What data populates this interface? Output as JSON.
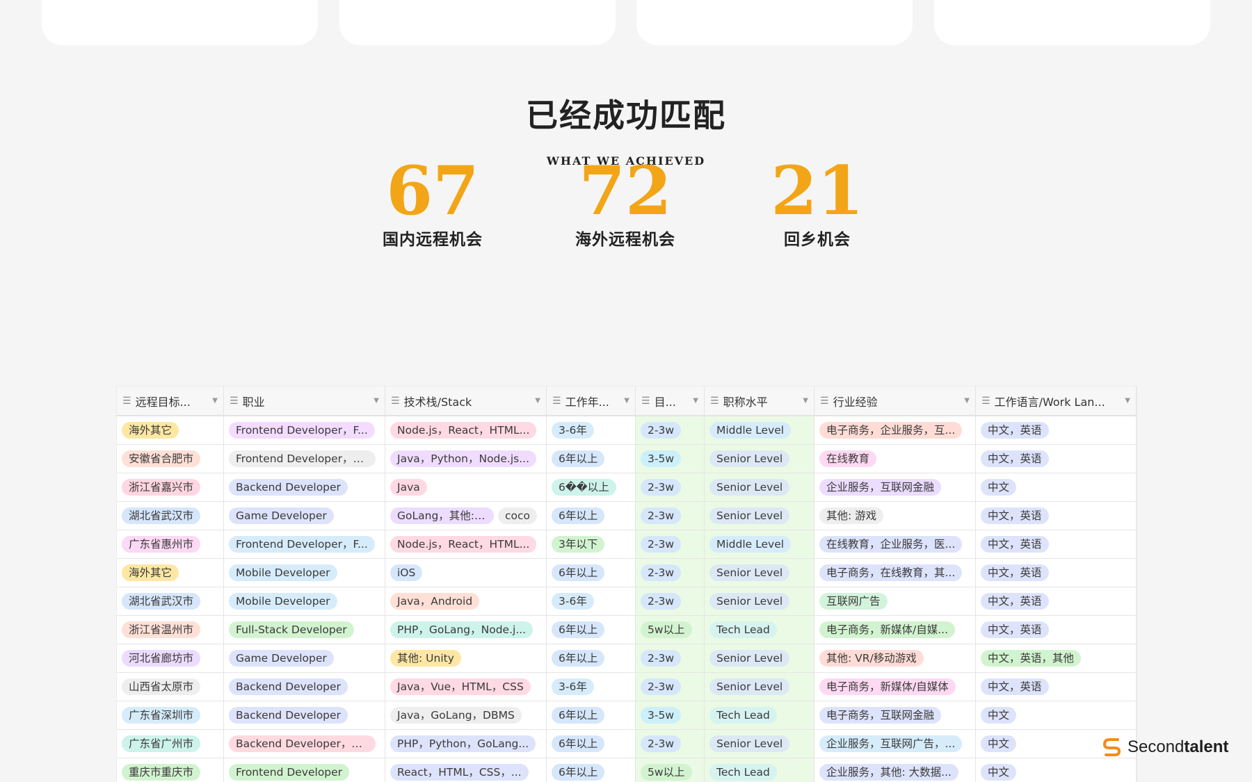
{
  "colors": {
    "accent": "#f2a516",
    "page_bg": "#f5f5f5"
  },
  "achieve": {
    "title": "已经成功匹配",
    "subtitle": "WHAT WE ACHIEVED",
    "stats": [
      {
        "value": "67",
        "label": "国内远程机会"
      },
      {
        "value": "72",
        "label": "海外远程机会"
      },
      {
        "value": "21",
        "label": "回乡机会"
      }
    ]
  },
  "table": {
    "field_icon": "field-list-icon",
    "columns": [
      "远程目标...",
      "职业",
      "技术栈/Stack",
      "工作年...",
      "目...",
      "职称水平",
      "行业经验",
      "工作语言/Work Lan..."
    ],
    "rows": [
      [
        {
          "t": "海外其它",
          "c": "#fde7a3"
        },
        {
          "t": "Frontend Developer，F...",
          "c": "#f3dcff"
        },
        {
          "t": "Node.js，React，HTML...",
          "c": "#ffd9e4"
        },
        {
          "t": "3-6年",
          "c": "#d6ecfb"
        },
        {
          "t": "2-3w",
          "c": "#d6e6fb"
        },
        {
          "t": "Middle Level",
          "c": "#d6ecfb"
        },
        {
          "t": "电子商务，企业服务，互...",
          "c": "#ffdcd6"
        },
        {
          "t": "中文，英语",
          "c": "#dde3fb"
        }
      ],
      [
        {
          "t": "安徽省合肥市",
          "c": "#fde0d6"
        },
        {
          "t": "Frontend Developer，B...",
          "c": "#eeeeee"
        },
        {
          "t": "Java，Python，Node.js...",
          "c": "#f0dcff"
        },
        {
          "t": "6年以上",
          "c": "#d6e6fb"
        },
        {
          "t": "3-5w",
          "c": "#cdeffb"
        },
        {
          "t": "Senior Level",
          "c": "#dde8f5"
        },
        {
          "t": "在线教育",
          "c": "#fdd9f2"
        },
        {
          "t": "中文，英语",
          "c": "#dde3fb"
        }
      ],
      [
        {
          "t": "浙江省嘉兴市",
          "c": "#ffd6e2"
        },
        {
          "t": "Backend Developer",
          "c": "#dde3fb"
        },
        {
          "t": "Java",
          "c": "#ffd9e4"
        },
        {
          "t": "6��以上",
          "c": "#cdf3ea"
        },
        {
          "t": "2-3w",
          "c": "#d6e6fb"
        },
        {
          "t": "Senior Level",
          "c": "#dde8f5"
        },
        {
          "t": "企业服务，互联网金融",
          "c": "#ecdcff"
        },
        {
          "t": "中文",
          "c": "#dde3fb"
        }
      ],
      [
        {
          "t": "湖北省武汉市",
          "c": "#d6e6fb"
        },
        {
          "t": "Game Developer",
          "c": "#dde3fb"
        },
        {
          "t": "GoLang，其他: c++",
          "c": "#ecdcff"
        },
        {
          "t": "6年以上",
          "c": "#d6e6fb"
        },
        {
          "t": "2-3w",
          "c": "#d6e6fb"
        },
        {
          "t": "Senior Level",
          "c": "#dde8f5"
        },
        {
          "t": "其他: 游戏",
          "c": "#eeeeee"
        },
        {
          "t": "中文，英语",
          "c": "#dde3fb"
        }
      ],
      [
        {
          "t": "广东省惠州市",
          "c": "#fcd9f5"
        },
        {
          "t": "Frontend Developer，F...",
          "c": "#d6ecfb"
        },
        {
          "t": "Node.js，React，HTML...",
          "c": "#ffd9e4"
        },
        {
          "t": "3年以下",
          "c": "#d2f3cf"
        },
        {
          "t": "2-3w",
          "c": "#d6e6fb"
        },
        {
          "t": "Middle Level",
          "c": "#d6ecfb"
        },
        {
          "t": "在线教育，企业服务，医...",
          "c": "#dde3fb"
        },
        {
          "t": "中文，英语",
          "c": "#dde3fb"
        }
      ],
      [
        {
          "t": "海外其它",
          "c": "#fde7a3"
        },
        {
          "t": "Mobile Developer",
          "c": "#d6ecfb"
        },
        {
          "t": "iOS",
          "c": "#d6e6fb"
        },
        {
          "t": "6年以上",
          "c": "#d6e6fb"
        },
        {
          "t": "2-3w",
          "c": "#d6e6fb"
        },
        {
          "t": "Senior Level",
          "c": "#dde8f5"
        },
        {
          "t": "电子商务，在线教育，其...",
          "c": "#dde3fb"
        },
        {
          "t": "中文，英语",
          "c": "#dde3fb"
        }
      ],
      [
        {
          "t": "湖北省武汉市",
          "c": "#d6e6fb"
        },
        {
          "t": "Mobile Developer",
          "c": "#d6ecfb"
        },
        {
          "t": "Java，Android",
          "c": "#ffdfd6"
        },
        {
          "t": "3-6年",
          "c": "#d6ecfb"
        },
        {
          "t": "2-3w",
          "c": "#d6e6fb"
        },
        {
          "t": "Senior Level",
          "c": "#dde8f5"
        },
        {
          "t": "互联网广告",
          "c": "#d2f3dc"
        },
        {
          "t": "中文，英语",
          "c": "#dde3fb"
        }
      ],
      [
        {
          "t": "浙江省温州市",
          "c": "#ffe0d6"
        },
        {
          "t": "Full-Stack Developer",
          "c": "#d2f3cf"
        },
        {
          "t": "PHP，GoLang，Node.j...",
          "c": "#cdf3ea"
        },
        {
          "t": "6年以上",
          "c": "#d6e6fb"
        },
        {
          "t": "5w以上",
          "c": "#d2f3cf"
        },
        {
          "t": "Tech Lead",
          "c": "#d6f3f0"
        },
        {
          "t": "电子商务，新媒体/自媒...",
          "c": "#d2f3cf"
        },
        {
          "t": "中文，英语",
          "c": "#dde3fb"
        }
      ],
      [
        {
          "t": "河北省廊坊市",
          "c": "#ecdcff"
        },
        {
          "t": "Game Developer",
          "c": "#dde3fb"
        },
        {
          "t": "其他: Unity",
          "c": "#fde7a3"
        },
        {
          "t": "6年以上",
          "c": "#d6e6fb"
        },
        {
          "t": "2-3w",
          "c": "#d6e6fb"
        },
        {
          "t": "Senior Level",
          "c": "#dde8f5"
        },
        {
          "t": "其他: VR/移动游戏",
          "c": "#ffdcd6"
        },
        {
          "t": "中文，英语，其他",
          "c": "#d2f3cf"
        }
      ],
      [
        {
          "t": "山西省太原市",
          "c": "#eeeeee"
        },
        {
          "t": "Backend Developer",
          "c": "#dde3fb"
        },
        {
          "t": "Java，Vue，HTML，CSS",
          "c": "#ffd9e4"
        },
        {
          "t": "3-6年",
          "c": "#d6ecfb"
        },
        {
          "t": "2-3w",
          "c": "#d6e6fb"
        },
        {
          "t": "Senior Level",
          "c": "#dde8f5"
        },
        {
          "t": "电子商务，新媒体/自媒体",
          "c": "#fdd9f2"
        },
        {
          "t": "中文，英语",
          "c": "#dde3fb"
        }
      ],
      [
        {
          "t": "广东省深圳市",
          "c": "#d6ecfb"
        },
        {
          "t": "Backend Developer",
          "c": "#dde3fb"
        },
        {
          "t": "Java，GoLang，DBMS",
          "c": "#eeeeee"
        },
        {
          "t": "6年以上",
          "c": "#d6e6fb"
        },
        {
          "t": "3-5w",
          "c": "#cdeffb"
        },
        {
          "t": "Tech Lead",
          "c": "#d6f3f0"
        },
        {
          "t": "电子商务，互联网金融",
          "c": "#dde3fb"
        },
        {
          "t": "中文",
          "c": "#dde3fb"
        }
      ],
      [
        {
          "t": "广东省广州市",
          "c": "#cdf3ea"
        },
        {
          "t": "Backend Developer，O...",
          "c": "#ffd9e0"
        },
        {
          "t": "PHP，Python，GoLang...",
          "c": "#dde3fb"
        },
        {
          "t": "6年以上",
          "c": "#d6e6fb"
        },
        {
          "t": "2-3w",
          "c": "#d6e6fb"
        },
        {
          "t": "Senior Level",
          "c": "#dde8f5"
        },
        {
          "t": "企业服务，互联网广告，...",
          "c": "#d6ecfb"
        },
        {
          "t": "中文",
          "c": "#dde3fb"
        }
      ],
      [
        {
          "t": "重庆市重庆市",
          "c": "#d2f3cf"
        },
        {
          "t": "Frontend Developer",
          "c": "#d2f3cf"
        },
        {
          "t": "React，HTML，CSS，...",
          "c": "#dde3fb"
        },
        {
          "t": "6年以上",
          "c": "#d6e6fb"
        },
        {
          "t": "5w以上",
          "c": "#d2f3cf"
        },
        {
          "t": "Tech Lead",
          "c": "#d6f3f0"
        },
        {
          "t": "企业服务，其他: 大数据...",
          "c": "#dde3fb"
        },
        {
          "t": "中文",
          "c": "#dde3fb"
        }
      ]
    ],
    "extra_tag": {
      "t": "coco",
      "c": "#eeeeee"
    }
  },
  "logo": {
    "icon": "secondtalent-s-icon",
    "part1": "Second",
    "part2": "talent"
  }
}
